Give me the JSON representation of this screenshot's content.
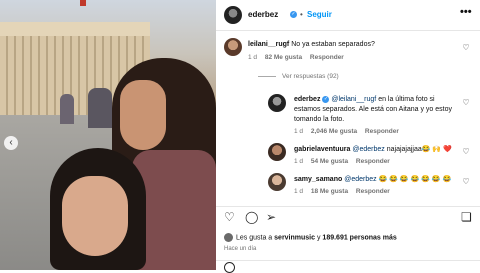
{
  "post": {
    "username": "ederbez",
    "follow_label": "Seguir",
    "separator": "•",
    "more_label": "•••"
  },
  "icons": {
    "verified": "verified-badge-icon",
    "heart": "heart-icon",
    "comment": "comment-icon",
    "share": "share-icon",
    "save": "bookmark-icon",
    "more": "more-options-icon",
    "prev": "chevron-left-icon",
    "emoji": "emoji-icon"
  },
  "comments": [
    {
      "username": "leilani__rugf",
      "text": "No ya estaban separados?",
      "time": "1 d",
      "likes": "82 Me gusta",
      "reply": "Responder"
    }
  ],
  "view_replies": "Ver respuestas (92)",
  "replies": [
    {
      "username": "ederbez",
      "mention": "@leilani__rugf",
      "text": "en la última foto si estamos separados. Ale está con Aitana y yo estoy tomando la foto.",
      "time": "1 d",
      "likes": "2,046 Me gusta",
      "reply": "Responder"
    },
    {
      "username": "gabrielaventuura",
      "mention": "@ederbez",
      "text": "najajajajjaa😂 🙌 ❤️",
      "time": "1 d",
      "likes": "54 Me gusta",
      "reply": "Responder"
    },
    {
      "username": "samy_samano",
      "mention": "@ederbez",
      "text": "😂 😂 😂 😂 😂 😂 😂",
      "time": "1 d",
      "likes": "18 Me gusta",
      "reply": "Responder"
    }
  ],
  "likes_line": {
    "prefix": "Les gusta a",
    "user": "servinmusic",
    "middle": "y",
    "count": "189.691 personas más"
  },
  "posted_time": "Hace un día",
  "colors": {
    "link": "#0095f6",
    "verified": "#3897f0",
    "mention": "#00376b"
  }
}
